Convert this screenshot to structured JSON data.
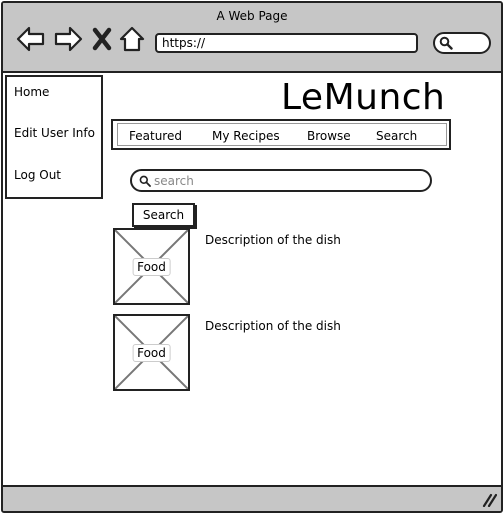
{
  "window": {
    "title": "A Web Page"
  },
  "browser": {
    "url": "https://",
    "icons": [
      "back-arrow-icon",
      "forward-arrow-icon",
      "close-x-icon",
      "home-icon",
      "search-icon"
    ]
  },
  "sidebar": {
    "items": [
      {
        "label": "Home"
      },
      {
        "label": "Edit User Info"
      },
      {
        "label": "Log Out"
      }
    ]
  },
  "header": {
    "brand": "LeMunch"
  },
  "nav": {
    "tabs": [
      {
        "label": "Featured"
      },
      {
        "label": "My Recipes"
      },
      {
        "label": "Browse"
      },
      {
        "label": "Search"
      }
    ]
  },
  "search": {
    "placeholder": "search",
    "value": "",
    "button_label": "Search"
  },
  "dishes": [
    {
      "image_label": "Food",
      "description": "Description of the dish"
    },
    {
      "image_label": "Food",
      "description": "Description of the dish"
    }
  ],
  "colors": {
    "chrome": "#c6c6c6",
    "stroke": "#222222",
    "background": "#ffffff"
  }
}
